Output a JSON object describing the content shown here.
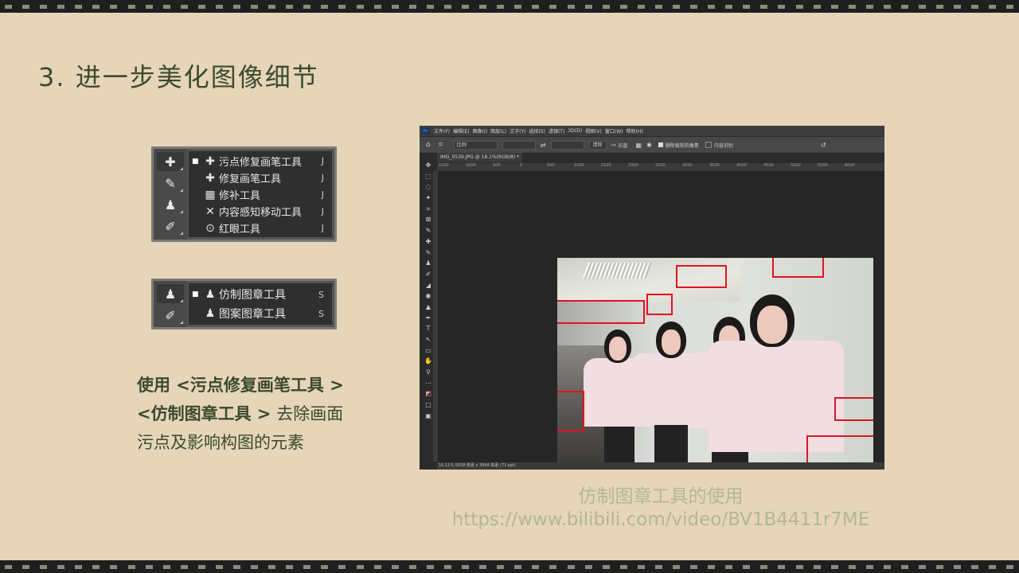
{
  "slide": {
    "title": "3. 进一步美化图像细节"
  },
  "healing_panel": {
    "tools": [
      {
        "label": "污点修复画笔工具",
        "key": "J",
        "selected": true,
        "icon": "spot-healing-brush-icon",
        "glyph": "✚"
      },
      {
        "label": "修复画笔工具",
        "key": "J",
        "selected": false,
        "icon": "healing-brush-icon",
        "glyph": "✚"
      },
      {
        "label": "修补工具",
        "key": "J",
        "selected": false,
        "icon": "patch-icon",
        "glyph": "▦"
      },
      {
        "label": "内容感知移动工具",
        "key": "J",
        "selected": false,
        "icon": "content-aware-move-icon",
        "glyph": "✕"
      },
      {
        "label": "红眼工具",
        "key": "J",
        "selected": false,
        "icon": "red-eye-icon",
        "glyph": "⊙"
      }
    ]
  },
  "stamp_panel": {
    "tools": [
      {
        "label": "仿制图章工具",
        "key": "S",
        "selected": true,
        "icon": "clone-stamp-icon",
        "glyph": "♟"
      },
      {
        "label": "图案图章工具",
        "key": "S",
        "selected": false,
        "icon": "pattern-stamp-icon",
        "glyph": "♟"
      }
    ]
  },
  "description": {
    "line1_bold": "使用 <污点修复画笔工具 >",
    "line2_bold": "<仿制图章工具 >",
    "line2_rest": " 去除画面",
    "line3": "污点及影响构图的元素"
  },
  "photoshop": {
    "menu": [
      "文件(F)",
      "编辑(E)",
      "图像(I)",
      "图层(L)",
      "文字(Y)",
      "选择(S)",
      "滤镜(T)",
      "3D(D)",
      "视图(V)",
      "窗口(W)",
      "帮助(H)"
    ],
    "options": {
      "ratio": "比例",
      "clear": "清除",
      "straighten": "拉直",
      "delete_cropped": "删除裁剪的像素",
      "content_aware": "内容识别"
    },
    "document_tab": "IMG_0539.JPG @ 16.1%(RGB/8) *",
    "ruler_ticks": [
      "1500",
      "1000",
      "500",
      "0",
      "500",
      "1000",
      "1500",
      "2000",
      "2500",
      "3000",
      "3500",
      "4000",
      "4500",
      "5000",
      "5500",
      "6000"
    ],
    "status": "16.11%    5838 像素 x 3864 像素 (72 ppi)"
  },
  "caption": {
    "title": "仿制图章工具的使用",
    "url": "https://www.bilibili.com/video/BV1B4411r7ME"
  },
  "colors": {
    "background": "#e6d5b8",
    "title_text": "#3c4a2f",
    "caption_text": "#b1b98f",
    "highlight_box": "#e0141e"
  }
}
